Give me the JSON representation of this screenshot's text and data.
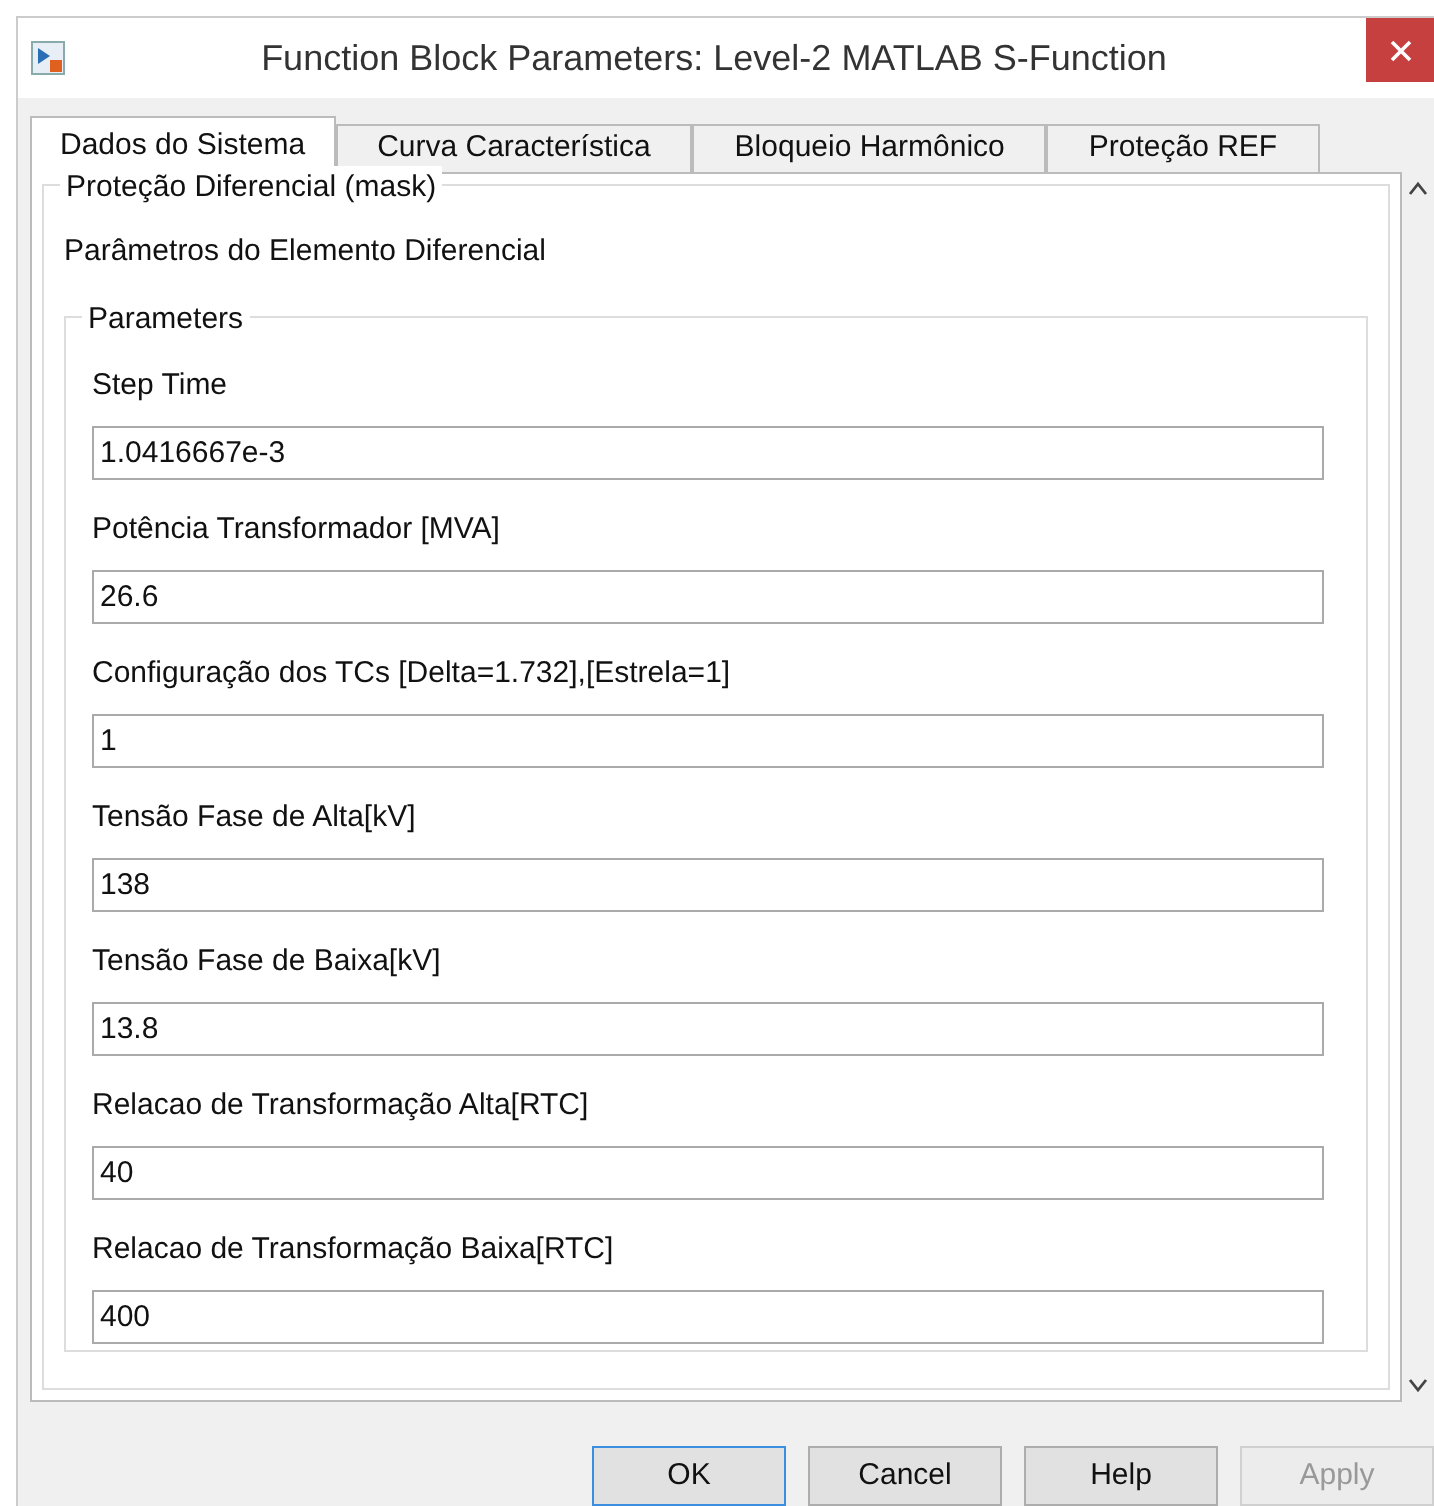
{
  "window": {
    "title": "Function Block Parameters: Level-2 MATLAB S-Function"
  },
  "tabs": [
    {
      "label": "Dados do Sistema",
      "selected": true
    },
    {
      "label": "Curva Característica",
      "selected": false
    },
    {
      "label": "Bloqueio Harmônico",
      "selected": false
    },
    {
      "label": "Proteção REF",
      "selected": false
    }
  ],
  "mask_group": {
    "title": "Proteção Diferencial (mask)",
    "description": "Parâmetros do Elemento Diferencial"
  },
  "parameters": {
    "title": "Parameters",
    "fields": [
      {
        "label": "Step Time",
        "value": "1.0416667e-3"
      },
      {
        "label": "Potência Transformador [MVA]",
        "value": "26.6"
      },
      {
        "label": "Configuração dos TCs [Delta=1.732],[Estrela=1]",
        "value": "1"
      },
      {
        "label": "Tensão Fase de Alta[kV]",
        "value": "138"
      },
      {
        "label": "Tensão Fase de Baixa[kV]",
        "value": "13.8"
      },
      {
        "label": "Relacao de Transformação Alta[RTC]",
        "value": "40"
      },
      {
        "label": "Relacao de Transformação Baixa[RTC]",
        "value": "400"
      }
    ]
  },
  "buttons": [
    {
      "label": "OK",
      "default": true,
      "disabled": false
    },
    {
      "label": "Cancel",
      "default": false,
      "disabled": false
    },
    {
      "label": "Help",
      "default": false,
      "disabled": false
    },
    {
      "label": "Apply",
      "default": false,
      "disabled": true
    }
  ]
}
